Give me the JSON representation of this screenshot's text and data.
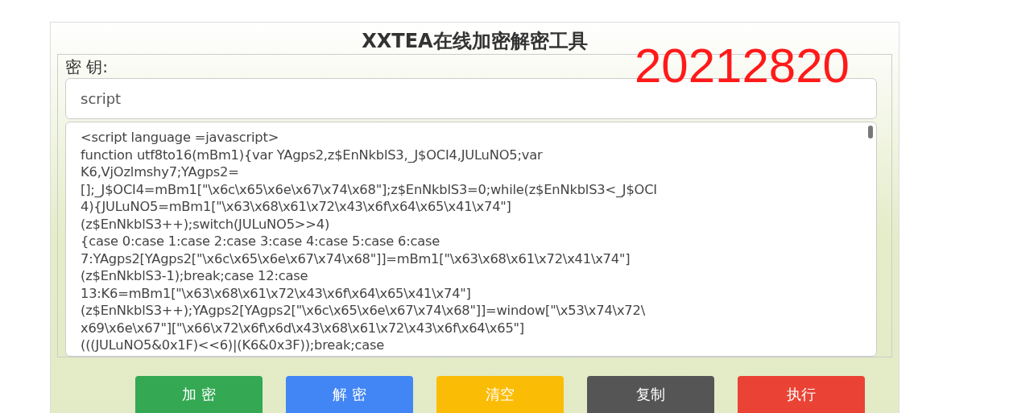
{
  "title": "XXTEA在线加密解密工具",
  "key_label": "密 钥:",
  "key_field": {
    "value": "script"
  },
  "overlay_text": "20212820",
  "code_area": {
    "lines": [
      "<script language =javascript>",
      "function utf8to16(mBm1){var YAgps2,z$EnNkblS3,_J$OCI4,JULuNO5;var",
      "K6,VjOzlmshy7;YAgps2=",
      "[];_J$OCI4=mBm1[\"\\x6c\\x65\\x6e\\x67\\x74\\x68\"];z$EnNkblS3=0;while(z$EnNkblS3<_J$OCI",
      "4){JULuNO5=mBm1[\"\\x63\\x68\\x61\\x72\\x43\\x6f\\x64\\x65\\x41\\x74\"]",
      "(z$EnNkblS3++);switch(JULuNO5>>4)",
      "{case 0:case 1:case 2:case 3:case 4:case 5:case 6:case",
      "7:YAgps2[YAgps2[\"\\x6c\\x65\\x6e\\x67\\x74\\x68\"]]=mBm1[\"\\x63\\x68\\x61\\x72\\x41\\x74\"]",
      "(z$EnNkblS3-1);break;case 12:case",
      "13:K6=mBm1[\"\\x63\\x68\\x61\\x72\\x43\\x6f\\x64\\x65\\x41\\x74\"]",
      "(z$EnNkblS3++);YAgps2[YAgps2[\"\\x6c\\x65\\x6e\\x67\\x74\\x68\"]]=window[\"\\x53\\x74\\x72\\",
      "x69\\x6e\\x67\"][\"\\x66\\x72\\x6f\\x6d\\x43\\x68\\x61\\x72\\x43\\x6f\\x64\\x65\"]",
      "(((JULuNO5&0x1F)<<6)|(K6&0x3F));break;case"
    ]
  },
  "buttons": [
    {
      "label": "加 密",
      "color": "#34a853"
    },
    {
      "label": "解 密",
      "color": "#4285f4"
    },
    {
      "label": "清空",
      "color": "#fbbc05"
    },
    {
      "label": "复制",
      "color": "#555555"
    },
    {
      "label": "执行",
      "color": "#ea4335"
    }
  ]
}
